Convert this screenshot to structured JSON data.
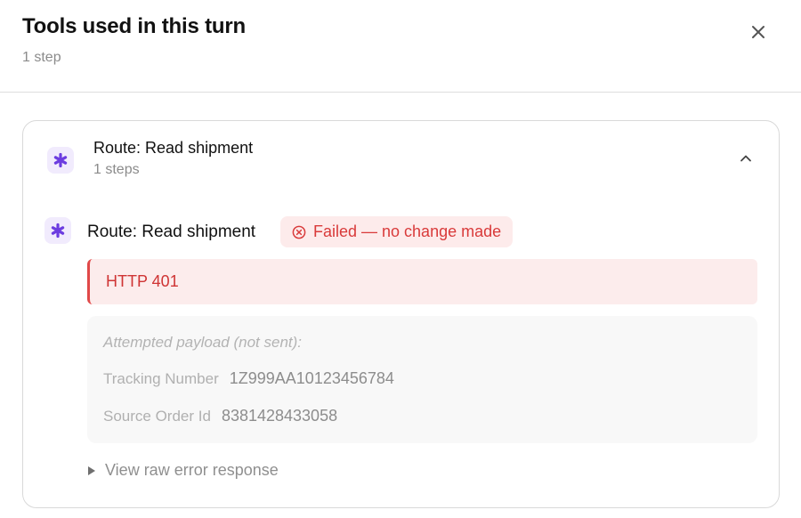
{
  "header": {
    "title": "Tools used in this turn",
    "subtitle": "1 step",
    "close_icon": "close-icon"
  },
  "group": {
    "icon": "puzzle-icon",
    "title": "Route: Read shipment",
    "steps": "1 steps",
    "toggle_icon": "chevron-up-icon"
  },
  "step": {
    "icon": "puzzle-icon",
    "title": "Route: Read shipment",
    "status": {
      "icon": "x-circle-icon",
      "label": "Failed — no change made",
      "color": "#d93a3a",
      "background": "#fdebeb"
    },
    "error": "HTTP 401",
    "payload": {
      "title": "Attempted payload (not sent):",
      "fields": [
        {
          "key": "Tracking Number",
          "value": "1Z999AA10123456784"
        },
        {
          "key": "Source Order Id",
          "value": "8381428433058"
        }
      ]
    },
    "raw_toggle": {
      "icon": "triangle-right-icon",
      "label": "View raw error response"
    }
  },
  "colors": {
    "accent_purple": "#6c3ce0",
    "error_red": "#d93a3a"
  }
}
